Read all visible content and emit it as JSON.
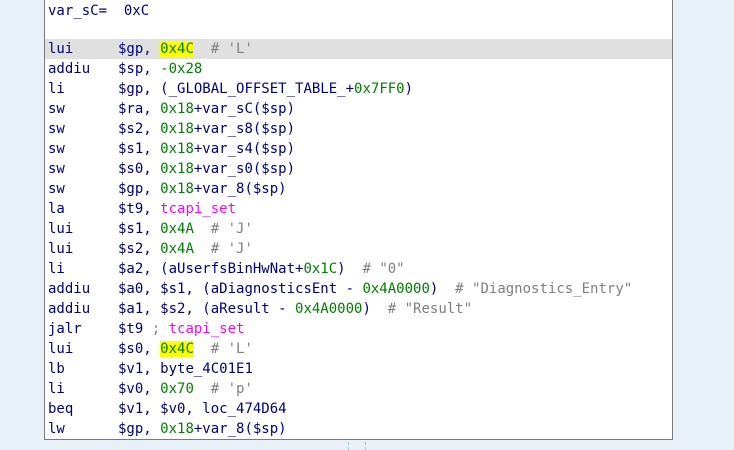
{
  "header": {
    "stack_var_label": "var_sC=  0xC"
  },
  "lines": [
    {
      "mnemonic": "lui",
      "operands": [
        {
          "t": "reg",
          "v": "$gp, "
        },
        {
          "t": "num",
          "v": "0x",
          "hl": true
        },
        {
          "t": "caret"
        },
        {
          "t": "num",
          "v": "4C",
          "hl": true
        },
        {
          "t": "cmt",
          "v": "  # 'L'"
        }
      ],
      "current": true
    },
    {
      "mnemonic": "addiu",
      "operands": [
        {
          "t": "reg",
          "v": "$sp, "
        },
        {
          "t": "num",
          "v": "-0x28"
        }
      ]
    },
    {
      "mnemonic": "li",
      "operands": [
        {
          "t": "reg",
          "v": "$gp, "
        },
        {
          "t": "sym",
          "v": "(_GLOBAL_OFFSET_TABLE_+"
        },
        {
          "t": "num",
          "v": "0x7FF0"
        },
        {
          "t": "sym",
          "v": ")"
        }
      ]
    },
    {
      "mnemonic": "sw",
      "operands": [
        {
          "t": "reg",
          "v": "$ra, "
        },
        {
          "t": "num",
          "v": "0x18"
        },
        {
          "t": "sym",
          "v": "+var_sC($sp)"
        }
      ]
    },
    {
      "mnemonic": "sw",
      "operands": [
        {
          "t": "reg",
          "v": "$s2, "
        },
        {
          "t": "num",
          "v": "0x18"
        },
        {
          "t": "sym",
          "v": "+var_s8($sp)"
        }
      ]
    },
    {
      "mnemonic": "sw",
      "operands": [
        {
          "t": "reg",
          "v": "$s1, "
        },
        {
          "t": "num",
          "v": "0x18"
        },
        {
          "t": "sym",
          "v": "+var_s4($sp)"
        }
      ]
    },
    {
      "mnemonic": "sw",
      "operands": [
        {
          "t": "reg",
          "v": "$s0, "
        },
        {
          "t": "num",
          "v": "0x18"
        },
        {
          "t": "sym",
          "v": "+var_s0($sp)"
        }
      ]
    },
    {
      "mnemonic": "sw",
      "operands": [
        {
          "t": "reg",
          "v": "$gp, "
        },
        {
          "t": "num",
          "v": "0x18"
        },
        {
          "t": "sym",
          "v": "+var_8($sp)"
        }
      ]
    },
    {
      "mnemonic": "la",
      "operands": [
        {
          "t": "reg",
          "v": "$t9, "
        },
        {
          "t": "ext",
          "v": "tcapi_set"
        }
      ]
    },
    {
      "mnemonic": "lui",
      "operands": [
        {
          "t": "reg",
          "v": "$s1, "
        },
        {
          "t": "num",
          "v": "0x4A"
        },
        {
          "t": "cmt",
          "v": "  # 'J'"
        }
      ]
    },
    {
      "mnemonic": "lui",
      "operands": [
        {
          "t": "reg",
          "v": "$s2, "
        },
        {
          "t": "num",
          "v": "0x4A"
        },
        {
          "t": "cmt",
          "v": "  # 'J'"
        }
      ]
    },
    {
      "mnemonic": "li",
      "operands": [
        {
          "t": "reg",
          "v": "$a2, "
        },
        {
          "t": "sym",
          "v": "(aUserfsBinHwNat+"
        },
        {
          "t": "num",
          "v": "0x1C"
        },
        {
          "t": "sym",
          "v": ")"
        },
        {
          "t": "cmt",
          "v": "  # \"0\""
        }
      ]
    },
    {
      "mnemonic": "addiu",
      "operands": [
        {
          "t": "reg",
          "v": "$a0, $s1, "
        },
        {
          "t": "sym",
          "v": "(aDiagnosticsEnt - "
        },
        {
          "t": "num",
          "v": "0x4A0000"
        },
        {
          "t": "sym",
          "v": ")"
        },
        {
          "t": "cmt",
          "v": "  # \"Diagnostics_Entry\""
        }
      ]
    },
    {
      "mnemonic": "addiu",
      "operands": [
        {
          "t": "reg",
          "v": "$a1, $s2, "
        },
        {
          "t": "sym",
          "v": "(aResult - "
        },
        {
          "t": "num",
          "v": "0x4A0000"
        },
        {
          "t": "sym",
          "v": ")"
        },
        {
          "t": "cmt",
          "v": "  # \"Result\""
        }
      ]
    },
    {
      "mnemonic": "jalr",
      "operands": [
        {
          "t": "reg",
          "v": "$t9"
        },
        {
          "t": "cmt",
          "v": " ; "
        },
        {
          "t": "ext",
          "v": "tcapi_set"
        }
      ]
    },
    {
      "mnemonic": "lui",
      "operands": [
        {
          "t": "reg",
          "v": "$s0, "
        },
        {
          "t": "num",
          "v": "0x4C",
          "hl": true
        },
        {
          "t": "cmt",
          "v": "  # 'L'"
        }
      ]
    },
    {
      "mnemonic": "lb",
      "operands": [
        {
          "t": "reg",
          "v": "$v1, "
        },
        {
          "t": "sym",
          "v": "byte_4C01E1"
        }
      ]
    },
    {
      "mnemonic": "li",
      "operands": [
        {
          "t": "reg",
          "v": "$v0, "
        },
        {
          "t": "num",
          "v": "0x70"
        },
        {
          "t": "cmt",
          "v": "  # 'p'"
        }
      ]
    },
    {
      "mnemonic": "beq",
      "operands": [
        {
          "t": "reg",
          "v": "$v1, $v0, "
        },
        {
          "t": "sym",
          "v": "loc_474D64"
        }
      ]
    },
    {
      "mnemonic": "lw",
      "operands": [
        {
          "t": "reg",
          "v": "$gp, "
        },
        {
          "t": "num",
          "v": "0x18"
        },
        {
          "t": "sym",
          "v": "+var_8($sp)"
        }
      ]
    }
  ]
}
